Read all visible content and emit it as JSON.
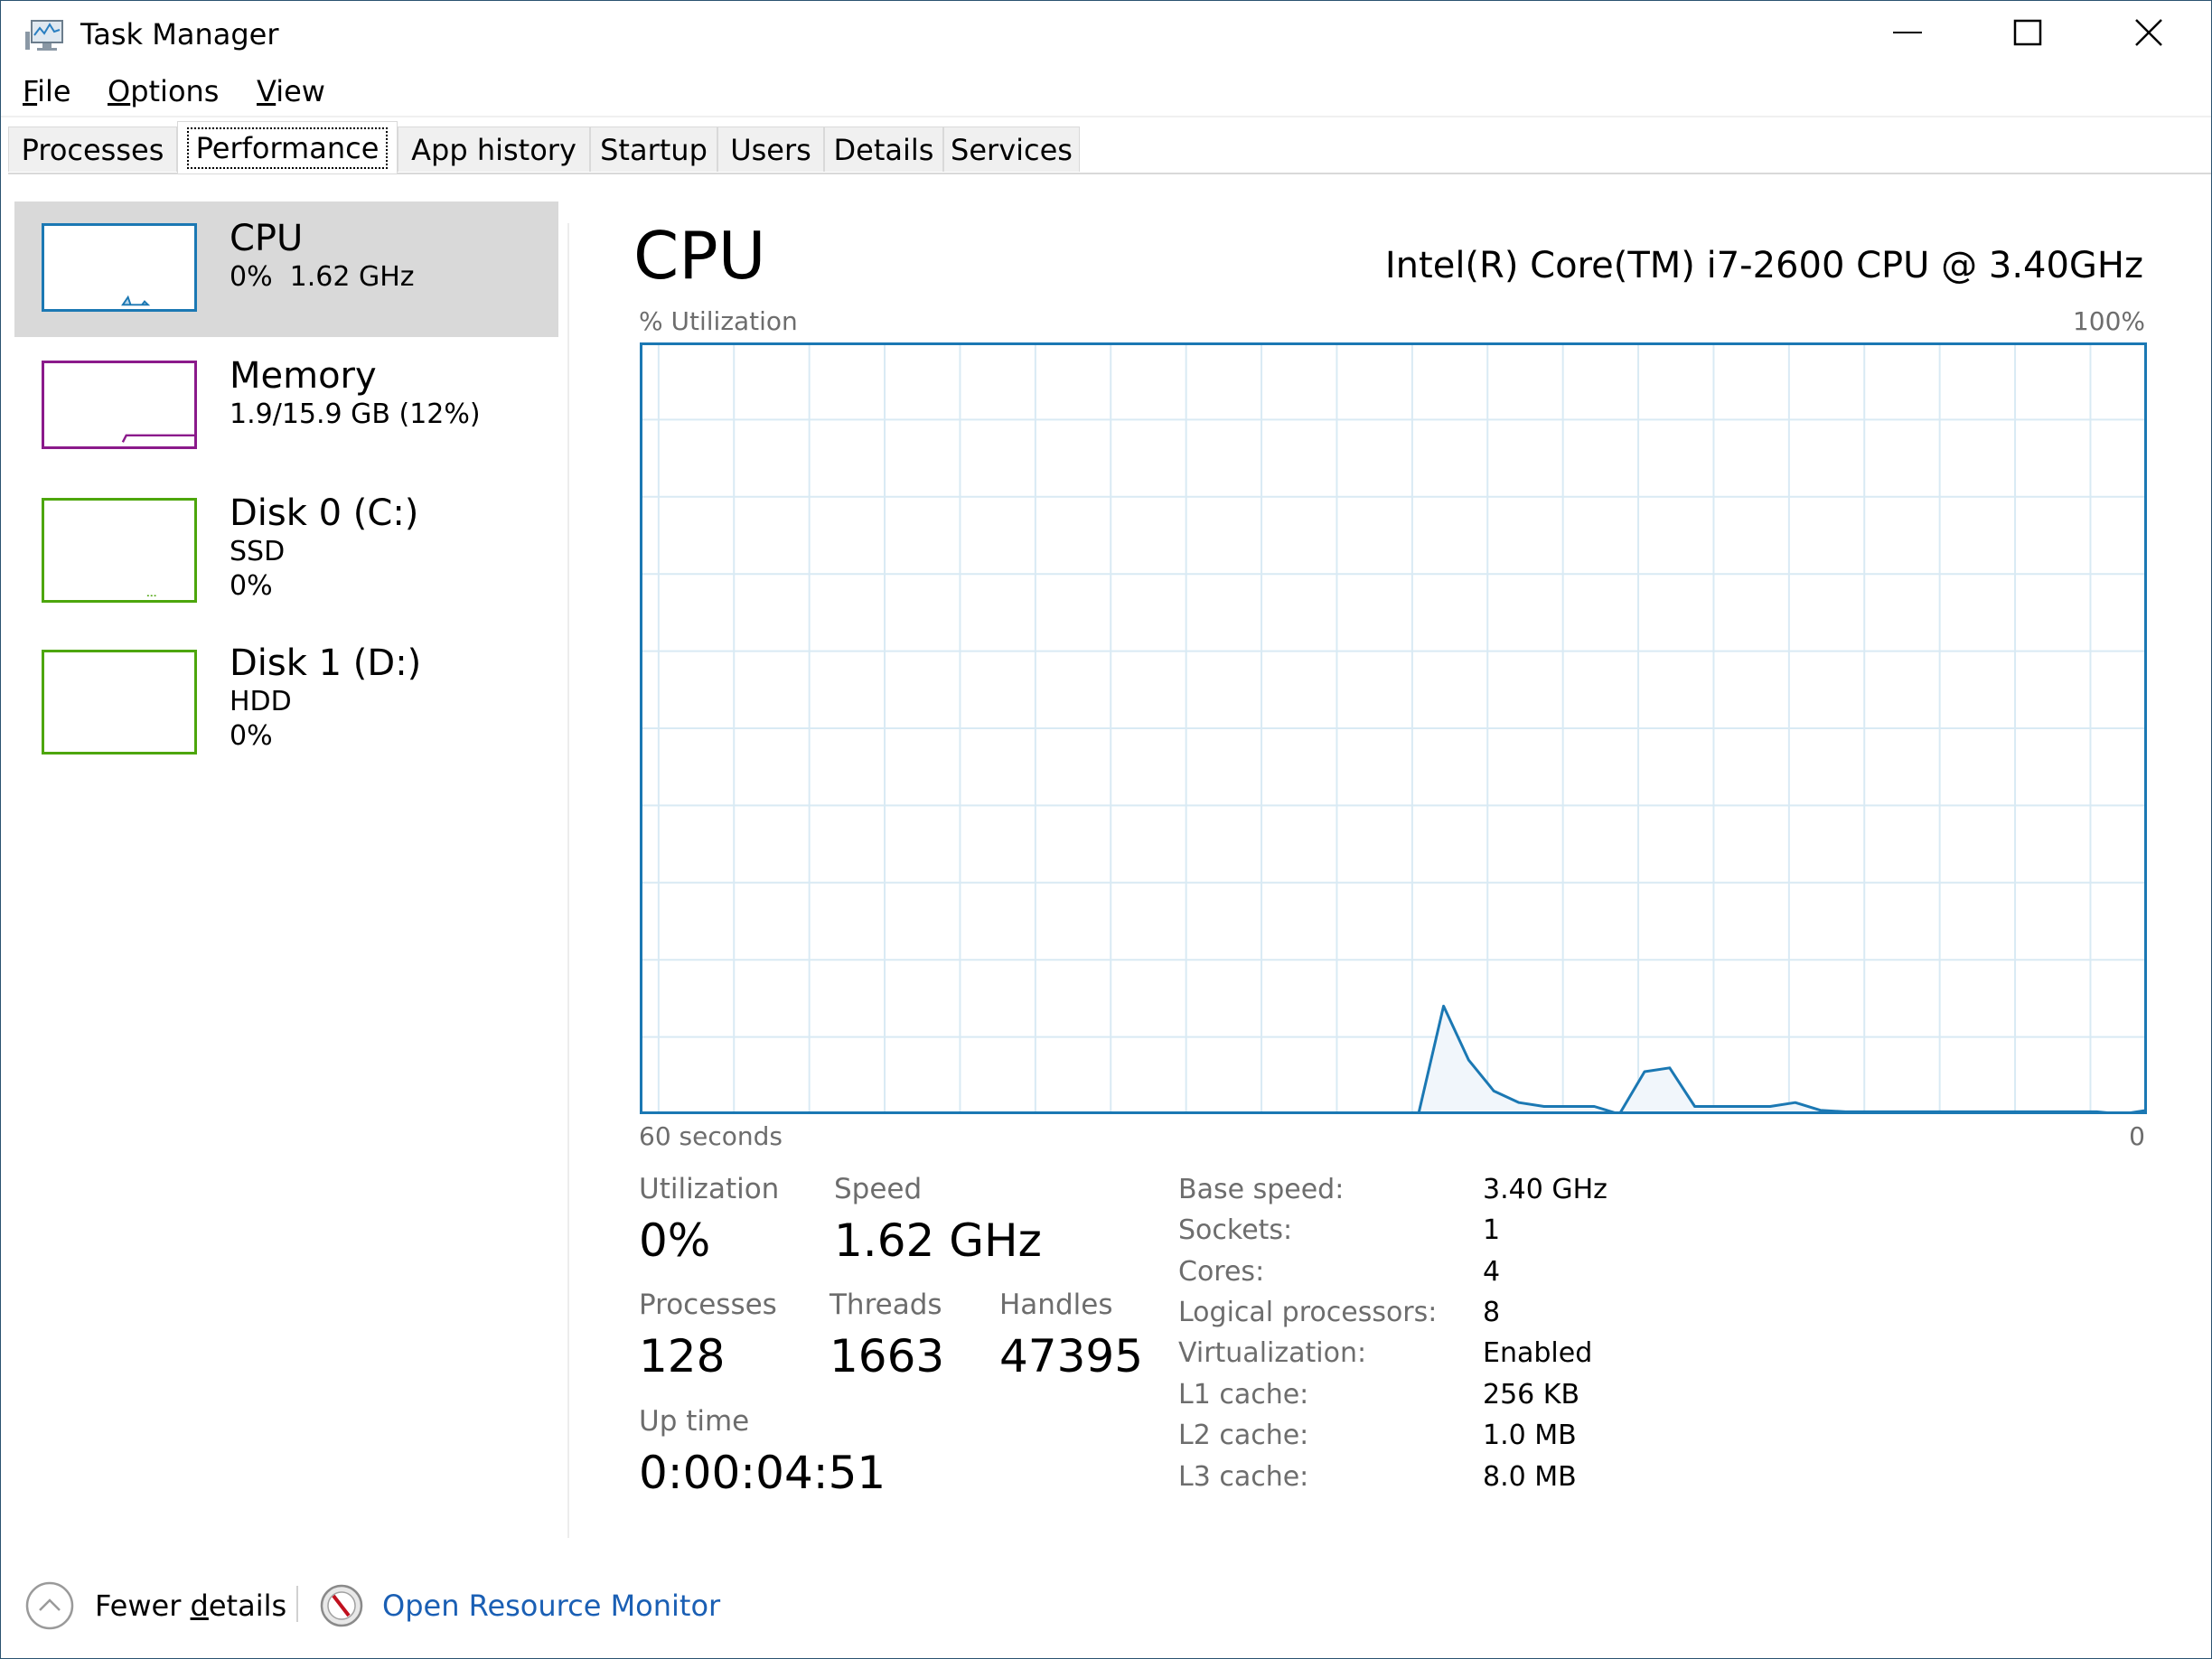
{
  "window": {
    "title": "Task Manager",
    "controls": {
      "minimize": "minimize",
      "maximize": "maximize",
      "close": "close"
    }
  },
  "menu": [
    {
      "label": "File",
      "mnemonic": "F",
      "rest": "ile"
    },
    {
      "label": "Options",
      "mnemonic": "O",
      "rest": "ptions"
    },
    {
      "label": "View",
      "mnemonic": "V",
      "rest": "iew"
    }
  ],
  "tabs": [
    {
      "label": "Processes",
      "active": false
    },
    {
      "label": "Performance",
      "active": true
    },
    {
      "label": "App history",
      "active": false
    },
    {
      "label": "Startup",
      "active": false
    },
    {
      "label": "Users",
      "active": false
    },
    {
      "label": "Details",
      "active": false
    },
    {
      "label": "Services",
      "active": false
    }
  ],
  "sidebar": {
    "items": [
      {
        "title": "CPU",
        "line1": "0%  1.62 GHz",
        "line2": "",
        "color": "#1b78b3",
        "selected": true
      },
      {
        "title": "Memory",
        "line1": "1.9/15.9 GB (12%)",
        "line2": "",
        "color": "#8b1a8b",
        "selected": false
      },
      {
        "title": "Disk 0 (C:)",
        "line1": "SSD",
        "line2": "0%",
        "color": "#4da60c",
        "selected": false
      },
      {
        "title": "Disk 1 (D:)",
        "line1": "HDD",
        "line2": "0%",
        "color": "#4da60c",
        "selected": false
      }
    ]
  },
  "main": {
    "title": "CPU",
    "model": "Intel(R) Core(TM) i7-2600 CPU @ 3.40GHz",
    "stats": {
      "utilization_label": "Utilization",
      "utilization": "0%",
      "speed_label": "Speed",
      "speed": "1.62 GHz",
      "processes_label": "Processes",
      "processes": "128",
      "threads_label": "Threads",
      "threads": "1663",
      "handles_label": "Handles",
      "handles": "47395",
      "uptime_label": "Up time",
      "uptime": "0:00:04:51"
    },
    "info": [
      {
        "label": "Base speed:",
        "value": "3.40 GHz"
      },
      {
        "label": "Sockets:",
        "value": "1"
      },
      {
        "label": "Cores:",
        "value": "4"
      },
      {
        "label": "Logical processors:",
        "value": "8"
      },
      {
        "label": "Virtualization:",
        "value": "Enabled"
      },
      {
        "label": "L1 cache:",
        "value": "256 KB"
      },
      {
        "label": "L2 cache:",
        "value": "1.0 MB"
      },
      {
        "label": "L3 cache:",
        "value": "8.0 MB"
      }
    ]
  },
  "footer": {
    "fewer_details": "Fewer details",
    "fewer_mnemonic_pre": "Fewer ",
    "fewer_mnemonic": "d",
    "fewer_mnemonic_post": "etails",
    "resource_monitor": "Open Resource Monitor"
  },
  "colors": {
    "cpu": "#1b78b3",
    "cpu_fill": "#f1f6fb",
    "grid": "#d9eaf4",
    "link": "#1a5fb4"
  },
  "chart_data": {
    "type": "area",
    "title": "% Utilization",
    "ylabel": "% Utilization",
    "ymax_label": "100%",
    "xlabel_left": "60 seconds",
    "xlabel_right": "0",
    "ylim": [
      0,
      100
    ],
    "xlim": [
      60,
      0
    ],
    "grid": true,
    "grid_rows": 10,
    "grid_cols": 20,
    "x": [
      60,
      59,
      58,
      57,
      56,
      55,
      54,
      53,
      52,
      51,
      50,
      49,
      48,
      47,
      46,
      45,
      44,
      43,
      42,
      41,
      40,
      39,
      38,
      37,
      36,
      35,
      34,
      33,
      32,
      31,
      30,
      29,
      28,
      27,
      26,
      25,
      24,
      23,
      22,
      21,
      20,
      19,
      18,
      17,
      16,
      15,
      14,
      13,
      12,
      11,
      10,
      9,
      8,
      7,
      6,
      5,
      4,
      3,
      2,
      1,
      0
    ],
    "series": [
      {
        "name": "CPU",
        "values": [
          0,
          0,
          0,
          0,
          0,
          0,
          0,
          0,
          0,
          0,
          0,
          0,
          0,
          0,
          0,
          0,
          0,
          0,
          0,
          0,
          0,
          0,
          0,
          0,
          0,
          0,
          0,
          0,
          0,
          0,
          0,
          0,
          14,
          7,
          3,
          1.5,
          1,
          1,
          1,
          0,
          5.5,
          6,
          1,
          1,
          1,
          1,
          1.5,
          0.5,
          0.3,
          0.3,
          0.3,
          0.3,
          0.3,
          0.3,
          0.3,
          0.3,
          0.3,
          0.3,
          0.3,
          0,
          0.5
        ]
      }
    ]
  }
}
